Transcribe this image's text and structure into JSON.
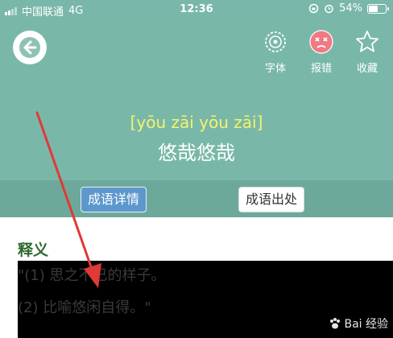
{
  "status_bar": {
    "carrier": "中国联通",
    "network": "4G",
    "time": "12:36",
    "battery": "54%"
  },
  "toolbar": {
    "font_label": "字体",
    "report_label": "报错",
    "favorite_label": "收藏"
  },
  "idiom": {
    "pinyin": "[yōu zāi yōu zāi]",
    "text": "悠哉悠哉"
  },
  "tabs": [
    {
      "label": "成语详情",
      "active": true
    },
    {
      "label": "成语出处",
      "active": false
    }
  ],
  "section": {
    "title": "释义",
    "definitions": [
      "\"(1) 思之不已的样子。",
      "(2) 比喻悠闲自得。\""
    ]
  },
  "watermark": "Bai 经验",
  "colors": {
    "header": "#79b8a9",
    "pinyin": "#f5f36a",
    "active_tab": "#5d98cc",
    "annotation_arrow": "#e03a36"
  }
}
